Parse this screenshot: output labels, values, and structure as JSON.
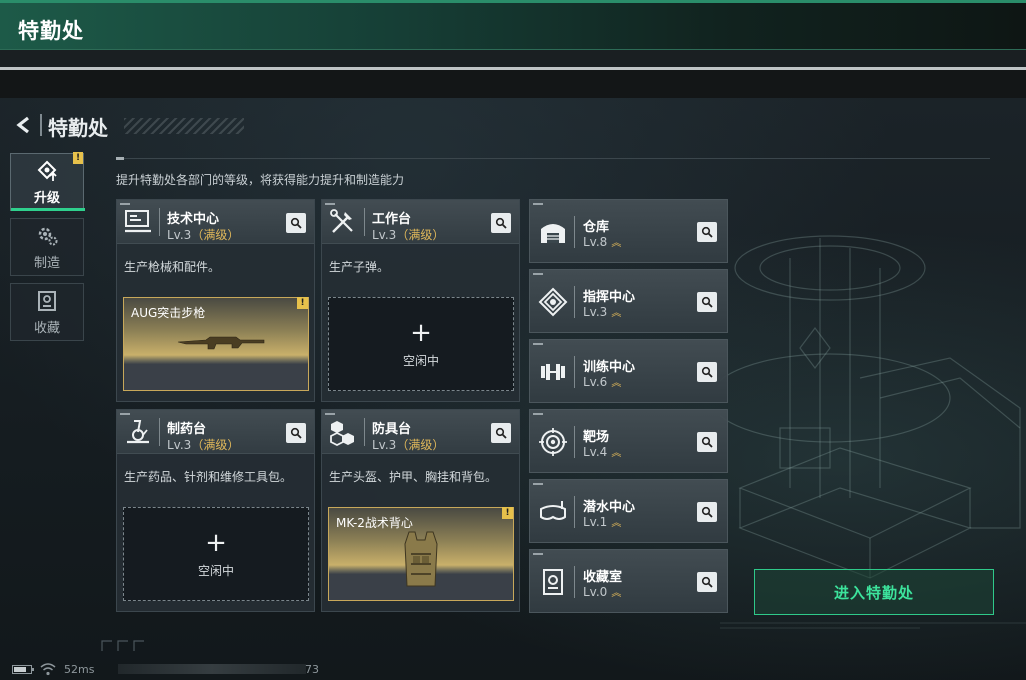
{
  "window": {
    "title": "特勤处"
  },
  "header": {
    "title": "特勤处"
  },
  "nav": {
    "items": [
      {
        "label": "升级",
        "icon": "upgrade-icon",
        "active": true,
        "badge": "!"
      },
      {
        "label": "制造",
        "icon": "gear-icon",
        "active": false
      },
      {
        "label": "收藏",
        "icon": "collection-icon",
        "active": false
      }
    ]
  },
  "subtitle": "提升特勤处各部门的等级，将获得能力提升和制造能力",
  "departments": [
    {
      "name": "技术中心",
      "level": "Lv.3",
      "max_label": "（满级）",
      "icon": "monitor-icon",
      "desc": "生产枪械和配件。",
      "slot": {
        "state": "item",
        "item_name": "AUG突击步枪",
        "badge": "!"
      }
    },
    {
      "name": "工作台",
      "level": "Lv.3",
      "max_label": "（满级）",
      "icon": "tools-icon",
      "desc": "生产子弹。",
      "slot": {
        "state": "empty",
        "plus": "+",
        "empty_label": "空闲中"
      }
    },
    {
      "name": "制药台",
      "level": "Lv.3",
      "max_label": "（满级）",
      "icon": "microscope-icon",
      "desc": "生产药品、针剂和维修工具包。",
      "slot": {
        "state": "empty",
        "plus": "+",
        "empty_label": "空闲中"
      }
    },
    {
      "name": "防具台",
      "level": "Lv.3",
      "max_label": "（满级）",
      "icon": "armor-blocks-icon",
      "desc": "生产头盔、护甲、胸挂和背包。",
      "slot": {
        "state": "item",
        "item_name": "MK-2战术背心",
        "badge": "!"
      }
    }
  ],
  "facilities": [
    {
      "name": "仓库",
      "level": "Lv.8",
      "icon": "warehouse-icon"
    },
    {
      "name": "指挥中心",
      "level": "Lv.3",
      "icon": "command-icon"
    },
    {
      "name": "训练中心",
      "level": "Lv.6",
      "icon": "dumbbell-icon"
    },
    {
      "name": "靶场",
      "level": "Lv.4",
      "icon": "target-icon"
    },
    {
      "name": "潜水中心",
      "level": "Lv.1",
      "icon": "diving-mask-icon"
    },
    {
      "name": "收藏室",
      "level": "Lv.0",
      "icon": "vault-icon"
    }
  ],
  "chevron": "︽",
  "enter_button": {
    "label": "进入特勤处"
  },
  "status": {
    "ping": "52ms",
    "uid_tail": "73"
  },
  "colors": {
    "accent_green": "#2fc98a",
    "gold": "#e0b85a",
    "badge_yellow": "#e7c14b"
  }
}
